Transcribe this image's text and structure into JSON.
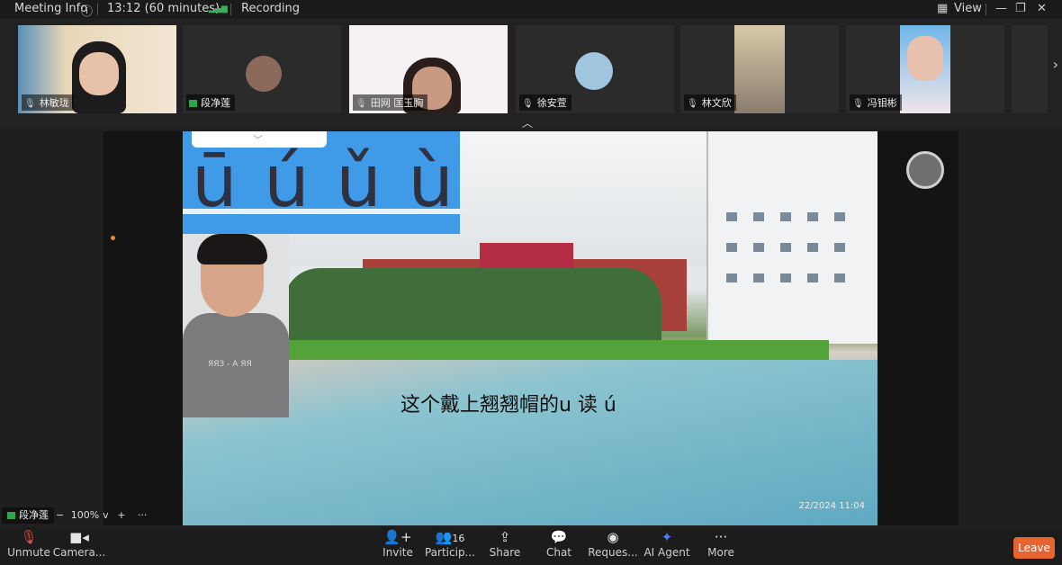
{
  "titlebar": {
    "meeting_info": "Meeting Info",
    "time": "13:12 (60 minutes)",
    "recording": "Recording",
    "view": "View"
  },
  "participants": [
    {
      "name": "林敏珑"
    },
    {
      "name": "段净莲"
    },
    {
      "name": "田网  匡玉胸"
    },
    {
      "name": "徐安萱"
    },
    {
      "name": "林文欣"
    },
    {
      "name": "冯钼彬"
    }
  ],
  "video": {
    "pinyin": "ū ú ǔ ù",
    "caption": "这个戴上翘翘帽的u 读 ú",
    "shirt_text": "ЯЯЗ - A ЯЯ",
    "timestamp": "22/2024  11:04"
  },
  "sharing": {
    "name": "段净莲",
    "zoom": "100%"
  },
  "toolbar": {
    "unmute": "Unmute",
    "camera": "Camera...",
    "invite": "Invite",
    "participants": "Particip...",
    "participant_count": "16",
    "share": "Share",
    "chat": "Chat",
    "requests": "Reques...",
    "ai_agent": "AI Agent",
    "more": "More",
    "leave": "Leave"
  }
}
